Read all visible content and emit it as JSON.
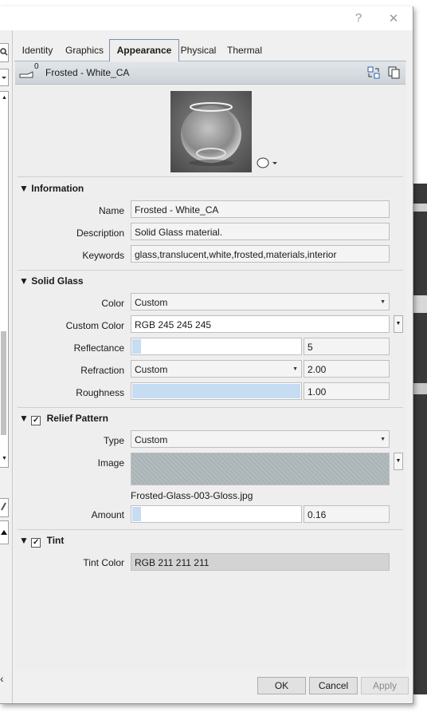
{
  "window": {
    "help_glyph": "?",
    "close_glyph": "✕"
  },
  "tabs": [
    "Identity",
    "Graphics",
    "Appearance",
    "Physical",
    "Thermal"
  ],
  "active_tab": "Appearance",
  "material": {
    "user_count": "0",
    "name": "Frosted - White_CA"
  },
  "information": {
    "title": "Information",
    "name_label": "Name",
    "name_value": "Frosted - White_CA",
    "description_label": "Description",
    "description_value": "Solid Glass material.",
    "keywords_label": "Keywords",
    "keywords_value": "glass,translucent,white,frosted,materials,interior"
  },
  "solid_glass": {
    "title": "Solid Glass",
    "color_label": "Color",
    "color_value": "Custom",
    "custom_color_label": "Custom Color",
    "custom_color_value": "RGB 245 245 245",
    "reflectance_label": "Reflectance",
    "reflectance_value": "5",
    "reflectance_fraction": 0.05,
    "refraction_label": "Refraction",
    "refraction_select": "Custom",
    "refraction_value": "2.00",
    "roughness_label": "Roughness",
    "roughness_value": "1.00",
    "roughness_fraction": 1.0
  },
  "relief_pattern": {
    "title": "Relief Pattern",
    "checked": true,
    "type_label": "Type",
    "type_value": "Custom",
    "image_label": "Image",
    "image_filename": "Frosted-Glass-003-Gloss.jpg",
    "amount_label": "Amount",
    "amount_value": "0.16",
    "amount_fraction": 0.05
  },
  "tint": {
    "title": "Tint",
    "checked": true,
    "tint_color_label": "Tint Color",
    "tint_color_value": "RGB 211 211 211"
  },
  "buttons": {
    "ok": "OK",
    "cancel": "Cancel",
    "apply": "Apply"
  },
  "colors": {
    "slider_fill": "#c5dcf2",
    "panel_bg": "#eeeeee"
  }
}
